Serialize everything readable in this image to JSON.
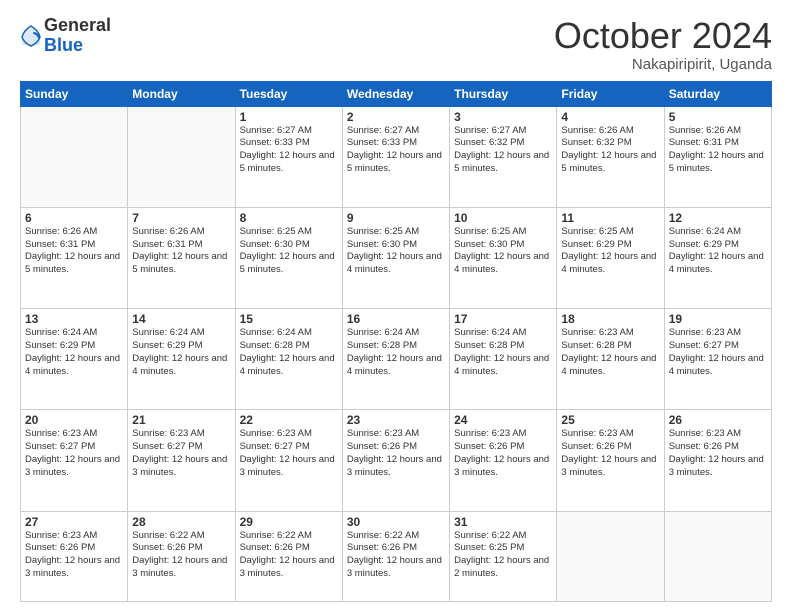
{
  "header": {
    "logo_general": "General",
    "logo_blue": "Blue",
    "month_title": "October 2024",
    "location": "Nakapiripirit, Uganda"
  },
  "days_of_week": [
    "Sunday",
    "Monday",
    "Tuesday",
    "Wednesday",
    "Thursday",
    "Friday",
    "Saturday"
  ],
  "weeks": [
    [
      {
        "day": "",
        "info": ""
      },
      {
        "day": "",
        "info": ""
      },
      {
        "day": "1",
        "info": "Sunrise: 6:27 AM\nSunset: 6:33 PM\nDaylight: 12 hours and 5 minutes."
      },
      {
        "day": "2",
        "info": "Sunrise: 6:27 AM\nSunset: 6:33 PM\nDaylight: 12 hours and 5 minutes."
      },
      {
        "day": "3",
        "info": "Sunrise: 6:27 AM\nSunset: 6:32 PM\nDaylight: 12 hours and 5 minutes."
      },
      {
        "day": "4",
        "info": "Sunrise: 6:26 AM\nSunset: 6:32 PM\nDaylight: 12 hours and 5 minutes."
      },
      {
        "day": "5",
        "info": "Sunrise: 6:26 AM\nSunset: 6:31 PM\nDaylight: 12 hours and 5 minutes."
      }
    ],
    [
      {
        "day": "6",
        "info": "Sunrise: 6:26 AM\nSunset: 6:31 PM\nDaylight: 12 hours and 5 minutes."
      },
      {
        "day": "7",
        "info": "Sunrise: 6:26 AM\nSunset: 6:31 PM\nDaylight: 12 hours and 5 minutes."
      },
      {
        "day": "8",
        "info": "Sunrise: 6:25 AM\nSunset: 6:30 PM\nDaylight: 12 hours and 5 minutes."
      },
      {
        "day": "9",
        "info": "Sunrise: 6:25 AM\nSunset: 6:30 PM\nDaylight: 12 hours and 4 minutes."
      },
      {
        "day": "10",
        "info": "Sunrise: 6:25 AM\nSunset: 6:30 PM\nDaylight: 12 hours and 4 minutes."
      },
      {
        "day": "11",
        "info": "Sunrise: 6:25 AM\nSunset: 6:29 PM\nDaylight: 12 hours and 4 minutes."
      },
      {
        "day": "12",
        "info": "Sunrise: 6:24 AM\nSunset: 6:29 PM\nDaylight: 12 hours and 4 minutes."
      }
    ],
    [
      {
        "day": "13",
        "info": "Sunrise: 6:24 AM\nSunset: 6:29 PM\nDaylight: 12 hours and 4 minutes."
      },
      {
        "day": "14",
        "info": "Sunrise: 6:24 AM\nSunset: 6:29 PM\nDaylight: 12 hours and 4 minutes."
      },
      {
        "day": "15",
        "info": "Sunrise: 6:24 AM\nSunset: 6:28 PM\nDaylight: 12 hours and 4 minutes."
      },
      {
        "day": "16",
        "info": "Sunrise: 6:24 AM\nSunset: 6:28 PM\nDaylight: 12 hours and 4 minutes."
      },
      {
        "day": "17",
        "info": "Sunrise: 6:24 AM\nSunset: 6:28 PM\nDaylight: 12 hours and 4 minutes."
      },
      {
        "day": "18",
        "info": "Sunrise: 6:23 AM\nSunset: 6:28 PM\nDaylight: 12 hours and 4 minutes."
      },
      {
        "day": "19",
        "info": "Sunrise: 6:23 AM\nSunset: 6:27 PM\nDaylight: 12 hours and 4 minutes."
      }
    ],
    [
      {
        "day": "20",
        "info": "Sunrise: 6:23 AM\nSunset: 6:27 PM\nDaylight: 12 hours and 3 minutes."
      },
      {
        "day": "21",
        "info": "Sunrise: 6:23 AM\nSunset: 6:27 PM\nDaylight: 12 hours and 3 minutes."
      },
      {
        "day": "22",
        "info": "Sunrise: 6:23 AM\nSunset: 6:27 PM\nDaylight: 12 hours and 3 minutes."
      },
      {
        "day": "23",
        "info": "Sunrise: 6:23 AM\nSunset: 6:26 PM\nDaylight: 12 hours and 3 minutes."
      },
      {
        "day": "24",
        "info": "Sunrise: 6:23 AM\nSunset: 6:26 PM\nDaylight: 12 hours and 3 minutes."
      },
      {
        "day": "25",
        "info": "Sunrise: 6:23 AM\nSunset: 6:26 PM\nDaylight: 12 hours and 3 minutes."
      },
      {
        "day": "26",
        "info": "Sunrise: 6:23 AM\nSunset: 6:26 PM\nDaylight: 12 hours and 3 minutes."
      }
    ],
    [
      {
        "day": "27",
        "info": "Sunrise: 6:23 AM\nSunset: 6:26 PM\nDaylight: 12 hours and 3 minutes."
      },
      {
        "day": "28",
        "info": "Sunrise: 6:22 AM\nSunset: 6:26 PM\nDaylight: 12 hours and 3 minutes."
      },
      {
        "day": "29",
        "info": "Sunrise: 6:22 AM\nSunset: 6:26 PM\nDaylight: 12 hours and 3 minutes."
      },
      {
        "day": "30",
        "info": "Sunrise: 6:22 AM\nSunset: 6:26 PM\nDaylight: 12 hours and 3 minutes."
      },
      {
        "day": "31",
        "info": "Sunrise: 6:22 AM\nSunset: 6:25 PM\nDaylight: 12 hours and 2 minutes."
      },
      {
        "day": "",
        "info": ""
      },
      {
        "day": "",
        "info": ""
      }
    ]
  ]
}
